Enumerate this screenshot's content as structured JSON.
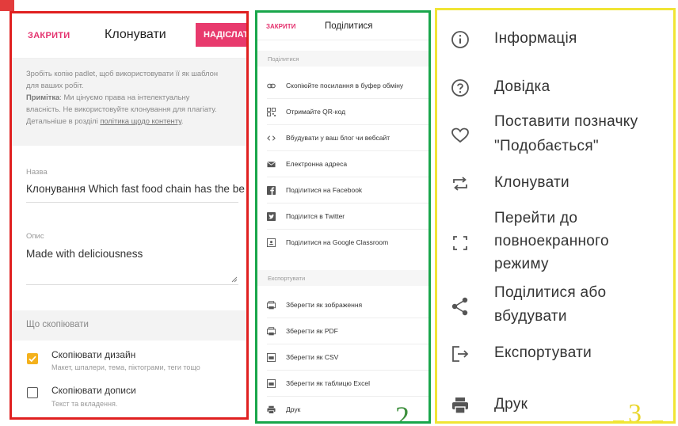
{
  "clone_panel": {
    "close_label": "ЗАКРИТИ",
    "title": "Клонувати",
    "submit_label": "НАДІСЛАТИ",
    "desc_line1": "Зробіть копію padlet, щоб використовувати її як шаблон",
    "desc_line2": "для ваших робіт.",
    "note_label": "Примітка",
    "note_text": ": Ми цінуємо права на інтелектуальну",
    "desc_line4": "власність. Не використовуйте клонування для плагіату.",
    "desc_line5_prefix": "Детальніше в розділі ",
    "policy_link": "політика щодо контенту",
    "desc_line5_suffix": ".",
    "name_label": "Назва",
    "name_value": "Клонування Which fast food chain has the be",
    "desc_label": "Опис",
    "desc_value": "Made with deliciousness",
    "copy_section": "Що скопіювати",
    "options": [
      {
        "title": "Скопіювати дизайн",
        "subtitle": "Макет, шпалери, тема, піктограми, теги тощо",
        "checked": true
      },
      {
        "title": "Скопіювати дописи",
        "subtitle": "Текст та вкладення.",
        "checked": false
      }
    ]
  },
  "share_panel": {
    "close_label": "ЗАКРИТИ",
    "title": "Поділитися",
    "share_group": "Поділитися",
    "share_items": [
      {
        "icon": "link-icon",
        "label": "Скопіюйте посилання в буфер обміну"
      },
      {
        "icon": "qr-code-icon",
        "label": "Отримайте QR-код"
      },
      {
        "icon": "embed-code-icon",
        "label": "Вбудувати у ваш блог чи вебсайт"
      },
      {
        "icon": "email-icon",
        "label": "Електронна адреса"
      },
      {
        "icon": "facebook-icon",
        "label": "Поділитися на Facebook"
      },
      {
        "icon": "twitter-icon",
        "label": "Поділится в Twitter"
      },
      {
        "icon": "google-classroom-icon",
        "label": "Поділитися на Google Classroom"
      }
    ],
    "export_group": "Експортувати",
    "export_items": [
      {
        "icon": "image-export-icon",
        "label": "Зберегти як зображення"
      },
      {
        "icon": "pdf-export-icon",
        "label": "Зберегти як PDF"
      },
      {
        "icon": "csv-export-icon",
        "label": "Зберегти як CSV"
      },
      {
        "icon": "excel-export-icon",
        "label": "Зберегти як таблицю Excel"
      },
      {
        "icon": "print-icon",
        "label": "Друк"
      }
    ],
    "panel_number": "2"
  },
  "menu_panel": {
    "items": [
      {
        "icon": "info-icon",
        "lines": [
          "Інформація"
        ]
      },
      {
        "icon": "help-icon",
        "lines": [
          "Довідка"
        ]
      },
      {
        "icon": "heart-icon",
        "lines": [
          "Поставити позначку",
          "\"Подобається\""
        ]
      },
      {
        "icon": "clone-icon",
        "lines": [
          "Клонувати"
        ]
      },
      {
        "icon": "fullscreen-icon",
        "lines": [
          "Перейти до",
          "повноекранного",
          "режиму"
        ]
      },
      {
        "icon": "share-icon",
        "lines": [
          "Поділитися або",
          "вбудувати"
        ]
      },
      {
        "icon": "export-icon",
        "lines": [
          "Експортувати"
        ]
      },
      {
        "icon": "print-icon",
        "lines": [
          "Друк"
        ]
      }
    ],
    "panel_number": "3"
  },
  "colors": {
    "panel1_border": "#e02020",
    "panel2_border": "#19a64b",
    "panel3_border": "#f0e535",
    "accent_pink": "#e4326e",
    "checkbox_checked": "#f4b11c"
  }
}
